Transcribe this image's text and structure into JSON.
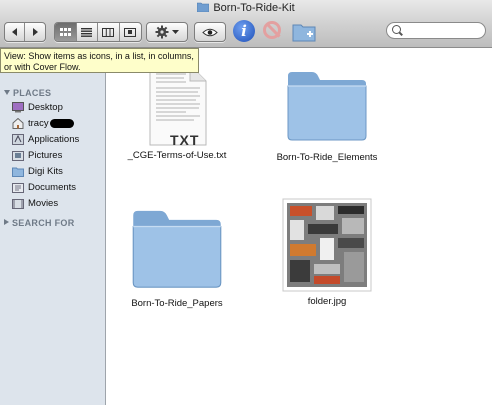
{
  "window": {
    "title": "Born-To-Ride-Kit"
  },
  "toolbar": {
    "back_icon": "back-arrow-icon",
    "forward_icon": "forward-arrow-icon",
    "views": [
      "icon-view",
      "list-view",
      "column-view",
      "cover-flow-view"
    ],
    "active_view": "icon-view",
    "action_icon": "gear-icon",
    "quicklook_icon": "eye-icon",
    "info_label": "i",
    "search_placeholder": ""
  },
  "tooltip": {
    "text": "View: Show items as icons, in a list, in columns, or with Cover Flow."
  },
  "sidebar": {
    "places_header": "PLACES",
    "search_header": "SEARCH FOR",
    "items": [
      {
        "label": "Desktop",
        "icon": "desktop-icon"
      },
      {
        "label": "tracy",
        "icon": "home-icon"
      },
      {
        "label": "Applications",
        "icon": "applications-icon"
      },
      {
        "label": "Pictures",
        "icon": "pictures-icon"
      },
      {
        "label": "Digi Kits",
        "icon": "folder-icon"
      },
      {
        "label": "Documents",
        "icon": "documents-icon"
      },
      {
        "label": "Movies",
        "icon": "movies-icon"
      }
    ]
  },
  "files": [
    {
      "name": "_CGE-Terms-of-Use.txt",
      "kind": "text-document",
      "badge": "TXT"
    },
    {
      "name": "Born-To-Ride_Elements",
      "kind": "folder"
    },
    {
      "name": "Born-To-Ride_Papers",
      "kind": "folder"
    },
    {
      "name": "folder.jpg",
      "kind": "image"
    }
  ],
  "colors": {
    "folder": "#8fb6de",
    "sidebar_bg": "#dde4ec",
    "tooltip_bg": "#fefeca"
  }
}
